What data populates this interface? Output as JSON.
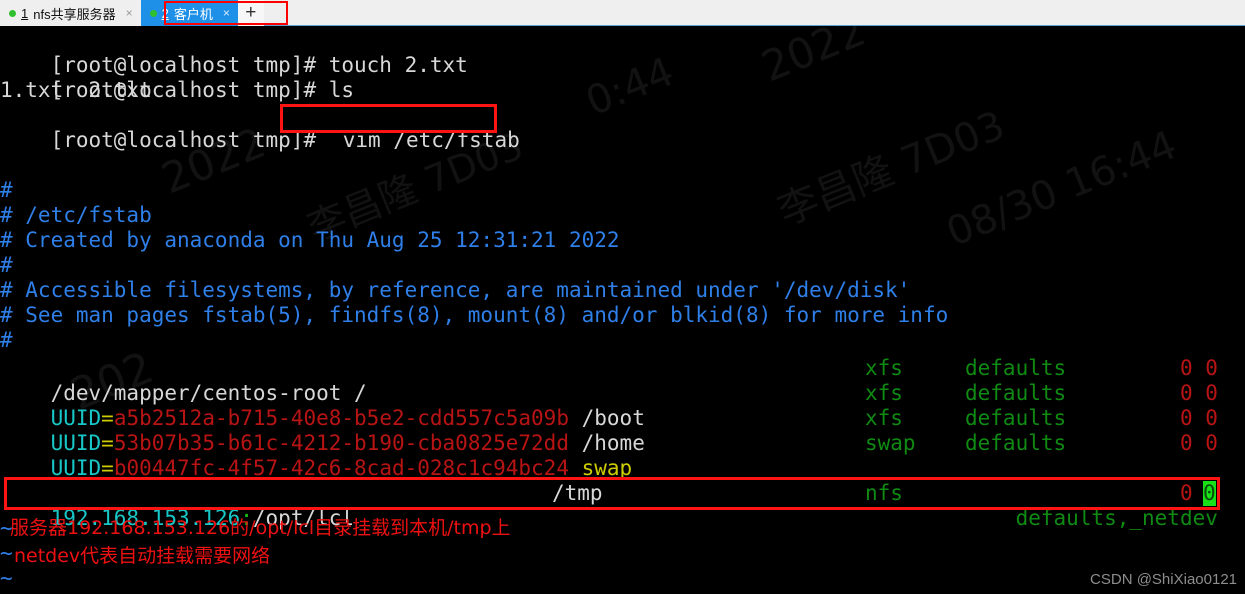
{
  "tabs": [
    {
      "num": "1",
      "label": "nfs共享服务器",
      "close": "×",
      "active": false,
      "dot": "session-active-dot"
    },
    {
      "num": "2",
      "label": "客户机",
      "close": "×",
      "active": true,
      "dot": "session-active-dot"
    }
  ],
  "new_tab_label": "+",
  "terminal": {
    "shell_lines": [
      {
        "prompt": "[root@localhost tmp]# ",
        "command": "touch 2.txt"
      },
      {
        "prompt": "[root@localhost tmp]# ",
        "command": "ls"
      },
      {
        "output": "1.txt  2.txt"
      },
      {
        "prompt": "[root@localhost tmp]# ",
        "command": "vim /etc/fstab"
      }
    ],
    "fstab_comments": [
      "#",
      "# /etc/fstab",
      "# Created by anaconda on Thu Aug 25 12:31:21 2022",
      "#",
      "# Accessible filesystems, by reference, are maintained under '/dev/disk'",
      "# See man pages fstab(5), findfs(8), mount(8) and/or blkid(8) for more info",
      "#"
    ],
    "fstab_entries": [
      {
        "device_plain": "/dev/mapper/centos-root /",
        "uuid_key": "",
        "uuid_value": "",
        "mount": "",
        "fstype": "xfs",
        "options": "defaults",
        "dump_pass": "0 0"
      },
      {
        "device_plain": "",
        "uuid_key": "UUID",
        "uuid_value": "a5b2512a-b715-40e8-b5e2-cdd557c5a09b",
        "mount": "/boot",
        "fstype": "xfs",
        "options": "defaults",
        "dump_pass": "0 0"
      },
      {
        "device_plain": "",
        "uuid_key": "UUID",
        "uuid_value": "53b07b35-b61c-4212-b190-cba0825e72dd",
        "mount": "/home",
        "fstype": "xfs",
        "options": "defaults",
        "dump_pass": "0 0"
      },
      {
        "device_plain": "",
        "uuid_key": "UUID",
        "uuid_value": "b00447fc-4f57-42c6-8cad-028c1c94bc24",
        "mount": "swap",
        "fstype": "swap",
        "options": "defaults",
        "dump_pass": "0 0"
      }
    ],
    "nfs_entry": {
      "server_ip": "192.168.153.126",
      "colon": ":",
      "export_path": "/opt/lcl",
      "mount": "/tmp",
      "fstype": "nfs",
      "options": "defaults,_netdev",
      "dump": "0",
      "pass_cursor": "0"
    },
    "tilde_marks": [
      "~",
      "~",
      "~"
    ],
    "equals": "="
  },
  "annotations": {
    "note_line_1": "服务器192.168.153.126的/opt/lcl目录挂载到本机/tmp上",
    "note_line_2": "netdev代表自动挂载需要网络"
  },
  "watermarks": {
    "top_center": "2022",
    "left_upper": "0:44",
    "mid_right": "李昌隆 7D03",
    "mid_right_2": "08/30 16:44",
    "lower_left": "202",
    "csdn": "CSDN @ShiXiao0121"
  },
  "colors": {
    "terminal_bg": "#000000",
    "comment_blue": "#2f7fe8",
    "uuid_cyan": "#18c7c7",
    "uuid_red": "#b81414",
    "fs_green": "#0f8a12",
    "annotation_red": "#ee1111",
    "highlight_box": "#ff1414",
    "active_tab": "#1e90e8",
    "cursor_green": "#19e019"
  }
}
